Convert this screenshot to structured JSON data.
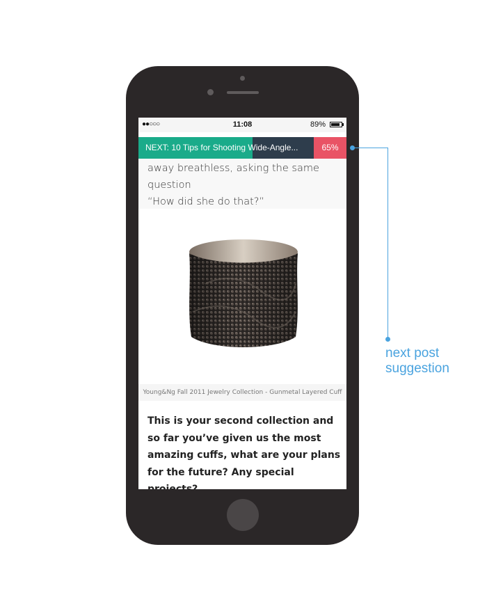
{
  "status_bar": {
    "signal": "●●○○○",
    "time": "11:08",
    "battery": "89%"
  },
  "next_bar": {
    "label": "NEXT: 10 Tips for Shooting Wide-Angle...",
    "progress_percent": "65%",
    "progress_fraction": 0.65
  },
  "article": {
    "intro_line1": "away breathless, asking the same question",
    "intro_line2": "“How did she do that?”",
    "image_caption": "Young&Ng Fall 2011 Jewelry Collection - Gunmetal Layered Cuff",
    "question": "This is your second collection and so far you’ve given us the most amazing cuffs, what are your plans for the future? Any special projects?"
  },
  "callout": {
    "line1": "next post",
    "line2": "suggestion"
  },
  "colors": {
    "next_bar_bg": "#2e3d4c",
    "progress_green": "#1aab8a",
    "percent_red": "#e95365",
    "callout_blue": "#4aa3df",
    "phone_body": "#2b2728"
  }
}
